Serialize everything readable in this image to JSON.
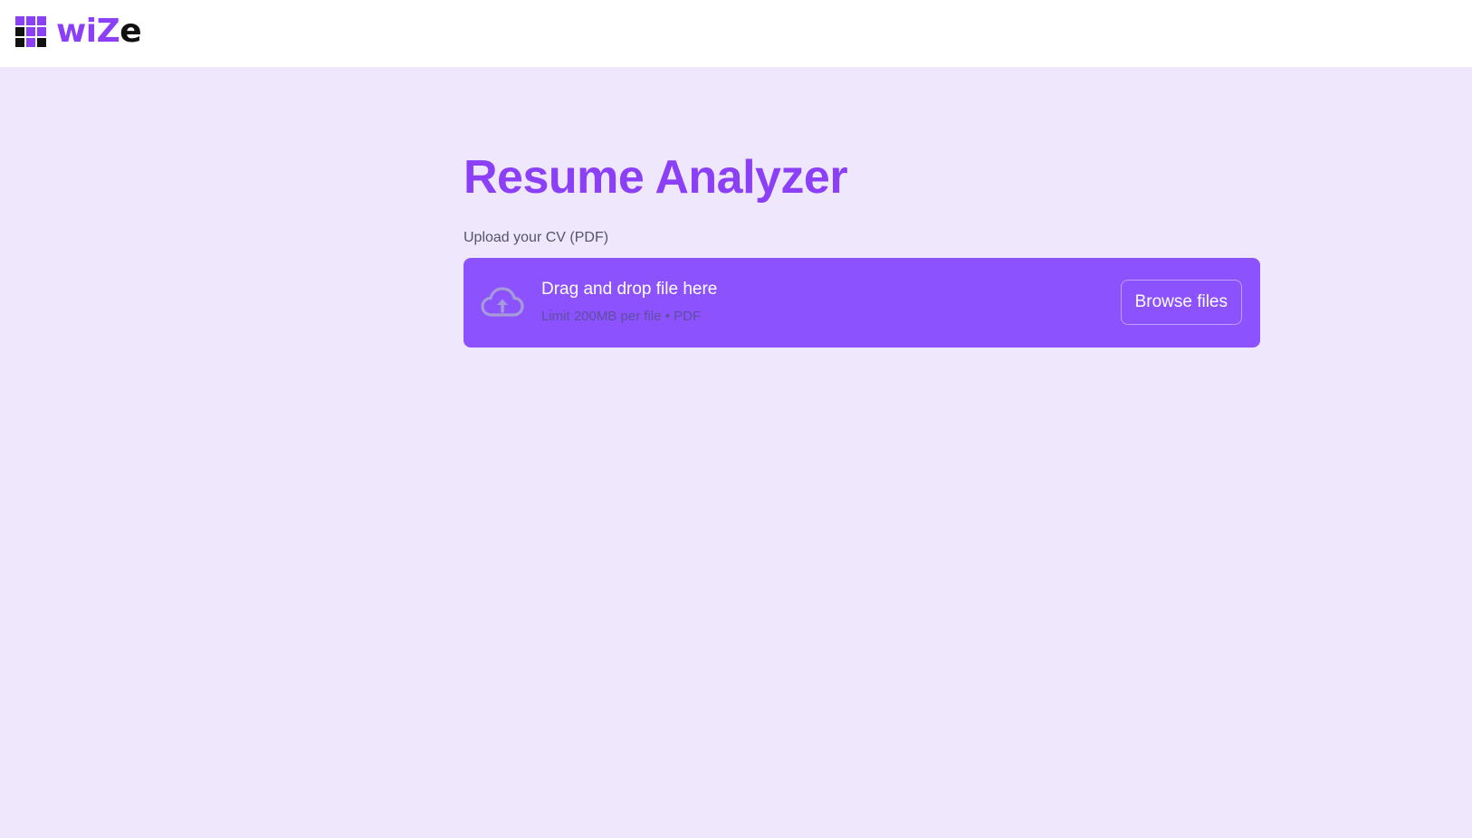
{
  "header": {
    "logo": {
      "text_main": "wiZ",
      "text_tail": "e",
      "icon": "grid-logo-icon",
      "grid_colors": [
        "#8b3ff6",
        "#8b3ff6",
        "#8b3ff6",
        "#111111",
        "#8b3ff6",
        "#8b3ff6",
        "#111111",
        "#8b3ff6",
        "#111111"
      ]
    }
  },
  "main": {
    "title": "Resume Analyzer",
    "uploader": {
      "label": "Upload your CV (PDF)",
      "icon": "cloud-upload-icon",
      "primary_text": "Drag and drop file here",
      "secondary_text": "Limit 200MB per file • PDF",
      "button_label": "Browse files"
    }
  },
  "colors": {
    "accent": "#8b3ff6",
    "dropzone": "#8b52fe",
    "background": "#efe7fb",
    "header": "#ffffff"
  }
}
